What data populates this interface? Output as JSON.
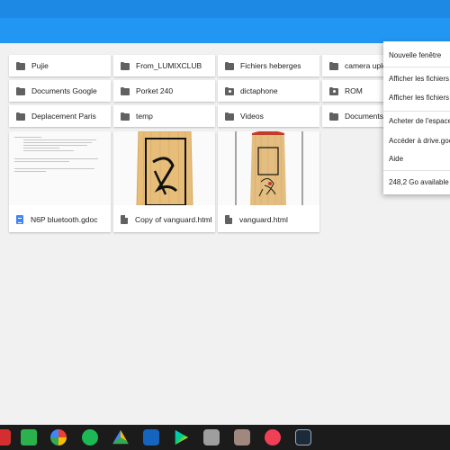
{
  "folders": [
    {
      "label": "Pujie",
      "icon": "folder-icon"
    },
    {
      "label": "From_LUMIXCLUB",
      "icon": "folder-icon"
    },
    {
      "label": "Fichiers heberges",
      "icon": "folder-icon"
    },
    {
      "label": "camera uploa",
      "icon": "folder-icon"
    },
    {
      "label": "Documents Google",
      "icon": "folder-icon"
    },
    {
      "label": "Porket 240",
      "icon": "folder-icon"
    },
    {
      "label": "dictaphone",
      "icon": "shared-folder-icon"
    },
    {
      "label": "ROM",
      "icon": "shared-folder-icon"
    },
    {
      "label": "Deplacement Paris",
      "icon": "folder-icon"
    },
    {
      "label": "temp",
      "icon": "folder-icon"
    },
    {
      "label": "Videos",
      "icon": "folder-icon"
    },
    {
      "label": "Documents d",
      "icon": "folder-icon"
    }
  ],
  "files": [
    {
      "label": "N6P bluetooth.gdoc",
      "icon": "google-doc-icon"
    },
    {
      "label": "Copy of vanguard.html",
      "icon": "html-file-icon"
    },
    {
      "label": "vanguard.html",
      "icon": "html-file-icon"
    }
  ],
  "menu": {
    "items": [
      "Nouvelle fenêtre",
      "Afficher les fichiers",
      "Afficher les fichiers",
      "Acheter de l'espace",
      "Accéder à drive.goo",
      "Aide"
    ],
    "storage": "248,2 Go available"
  },
  "taskbar": {
    "apps": [
      {
        "icon": "pdf-app-icon",
        "color": "#d32f2f"
      },
      {
        "icon": "feedly-icon",
        "color": "#2bb24c"
      },
      {
        "icon": "photos-pinwheel-icon",
        "color": "#ea4335"
      },
      {
        "icon": "spotify-icon",
        "color": "#1db954"
      },
      {
        "icon": "google-drive-icon",
        "color": "#fbbc04"
      },
      {
        "icon": "image-viewer-icon",
        "color": "#1565c0"
      },
      {
        "icon": "play-store-icon",
        "color": "#00a0f0"
      },
      {
        "icon": "gallery-icon",
        "color": "#9e9e9e"
      },
      {
        "icon": "archive-box-icon",
        "color": "#a1887f"
      },
      {
        "icon": "pocket-icon",
        "color": "#ef4056"
      },
      {
        "icon": "lightroom-icon",
        "color": "#1d2a3a"
      }
    ]
  }
}
